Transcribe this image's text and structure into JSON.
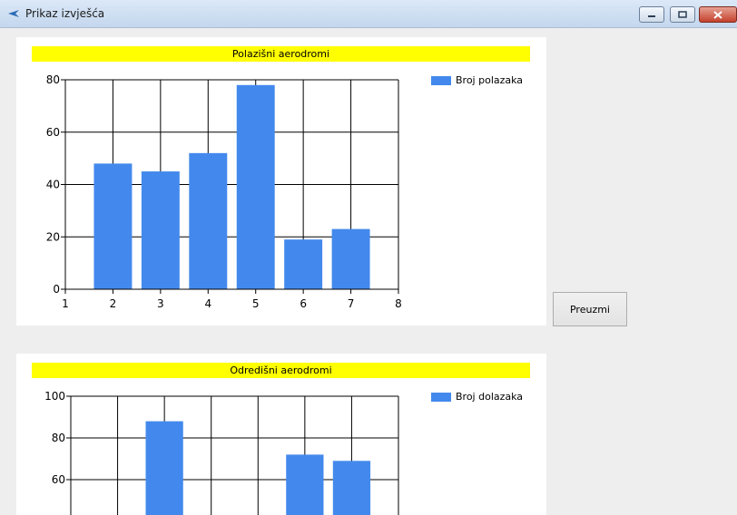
{
  "window": {
    "title": "Prikaz izvješća"
  },
  "button": {
    "label": "Preuzmi"
  },
  "chart_data": [
    {
      "type": "bar",
      "title": "Polazišni aerodromi",
      "legend": "Broj polazaka",
      "legend_position": "top-right",
      "grid": true,
      "x": [
        2,
        3,
        4,
        5,
        6,
        7
      ],
      "values": [
        48,
        45,
        52,
        78,
        19,
        23
      ],
      "xlim": [
        1,
        8
      ],
      "ylim": [
        0,
        80
      ],
      "xticks": [
        1,
        2,
        3,
        4,
        5,
        6,
        7,
        8
      ],
      "yticks": [
        0,
        20,
        40,
        60,
        80
      ],
      "color": "#4389ed"
    },
    {
      "type": "bar",
      "title": "Odredišni aerodromi",
      "legend": "Broj dolazaka",
      "legend_position": "top-right",
      "grid": true,
      "x": [
        3,
        6,
        7
      ],
      "values": [
        88,
        72,
        69
      ],
      "xlim": [
        1,
        8
      ],
      "ylim": [
        0,
        100
      ],
      "yticks_visible": [
        60,
        80,
        100
      ],
      "color": "#4389ed"
    }
  ]
}
